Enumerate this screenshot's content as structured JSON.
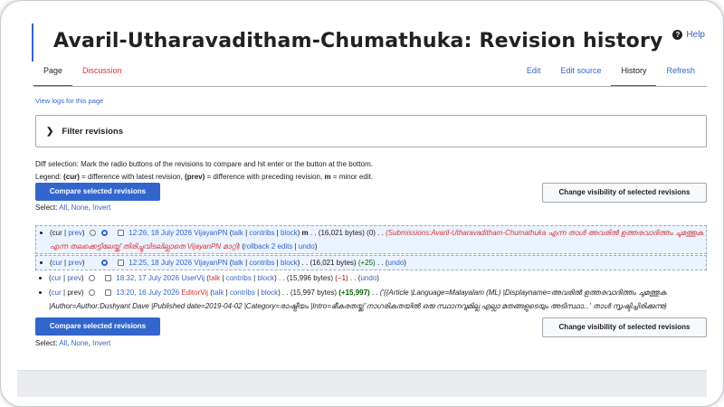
{
  "page": {
    "title": "Avaril-Utharavaditham-Chumathuka: Revision history",
    "help": "Help",
    "tabs_left": [
      "Page",
      "Discussion"
    ],
    "tabs_right": [
      "Edit",
      "Edit source",
      "History",
      "Refresh"
    ],
    "view_logs": "View logs for this page"
  },
  "filter": {
    "label": "Filter revisions",
    "chevron": "❯"
  },
  "legend": {
    "diff_selection": "Diff selection: Mark the radio buttons of the revisions to compare and hit enter or the button at the bottom.",
    "prefix": "Legend: ",
    "cur": "(cur)",
    "cur_text": " = difference with latest revision, ",
    "prev": "(prev)",
    "prev_text": " = difference with preceding revision, ",
    "m": "m",
    "m_text": " = minor edit."
  },
  "buttons": {
    "compare": "Compare selected revisions",
    "visibility": "Change visibility of selected revisions"
  },
  "select": {
    "label": "Select: ",
    "all": "All",
    "none": "None",
    "invert": "Invert",
    "sep": ", "
  },
  "revisions": [
    {
      "cur": "cur",
      "prev": "prev",
      "date": "12:26, 18 July 2026",
      "user": "VijayanPN",
      "talk": "talk",
      "contribs": "contribs",
      "block": "block",
      "minor": "m",
      "bytes": "(16,021 bytes)",
      "diff": "(0)",
      "summary": "(Submissions:Avaril-Utharavaditham-Chumathuka എന്ന താൾ അവരിൽ ഉത്തരവാദിത്തം ചുമത്തുക എന്ന തലക്കെട്ടിലേയ്ക്ക് തിരിച്ചുവിടലില്ലാതെ VijayanPN മാറ്റി)",
      "rollback": "rollback 2 edits",
      "undo": "undo"
    },
    {
      "cur": "cur",
      "prev": "prev",
      "date": "12:25, 18 July 2026",
      "user": "VijayanPN",
      "talk": "talk",
      "contribs": "contribs",
      "block": "block",
      "bytes": "(16,021 bytes)",
      "diff": "(+25)",
      "undo": "undo"
    },
    {
      "cur": "cur",
      "prev": "prev",
      "date": "18:32, 17 July 2026",
      "user": "UserVij",
      "talk": "talk",
      "contribs": "contribs",
      "block": "block",
      "bytes": "(15,996 bytes)",
      "diff": "(−1)",
      "undo": "undo"
    },
    {
      "cur": "cur",
      "prev": "prev",
      "date": "13:20, 16 July 2026",
      "user": "EditorVij",
      "talk": "talk",
      "contribs": "contribs",
      "block": "block",
      "bytes": "(15,997 bytes)",
      "diff": "(+15,997)",
      "summary": "('{{Article |Language=Malayalam (ML) |Displayname=അവരിൽ ഉത്തരവാദിത്തം ചുമത്തുക |Author=Author:Dushyant Dave |Published date=2019-04-02 |Category=രാഷ്ട്രീയം |Intro=ഭീകരതയ്ക്ക് നാഗരികതയിൽ ഒരു സ്ഥാനവുമില്ല എല്ലാ മതങ്ങളുടെയും അടിസ്ഥാ...' താൾ സൃഷ്ടിച്ചിരിക്കുന്നു)"
    }
  ],
  "colors": {
    "link": "#3366cc",
    "red_link": "#d73333",
    "positive": "#006400",
    "negative": "#8b0000",
    "accent": "#3366cc"
  }
}
